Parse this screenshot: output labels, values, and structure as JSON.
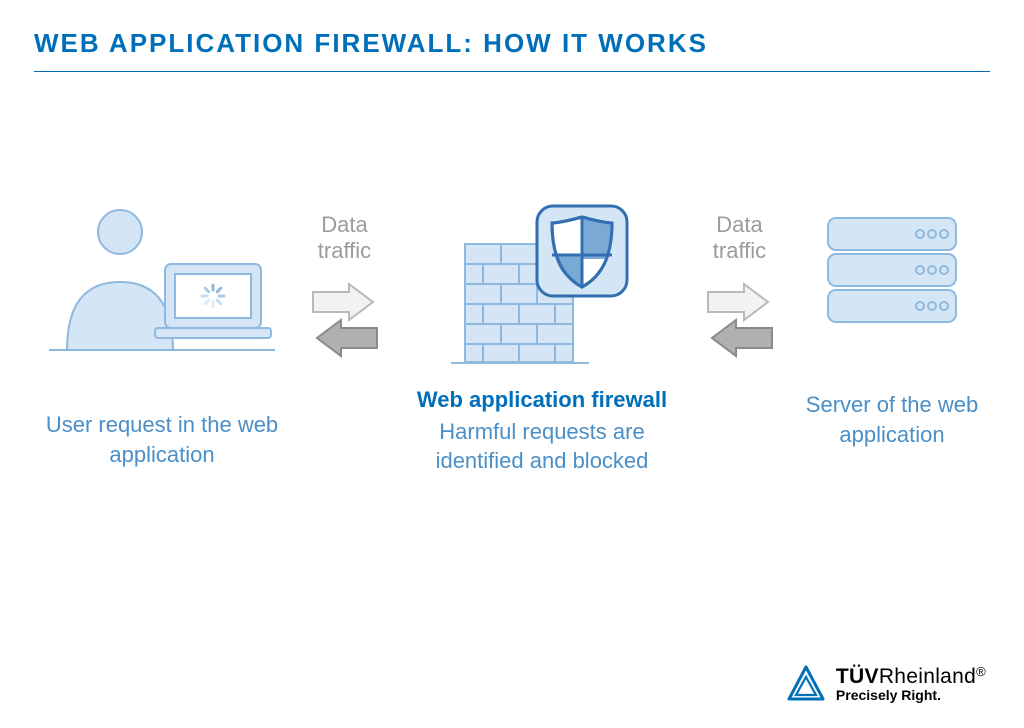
{
  "title": "WEB APPLICATION FIREWALL: HOW IT WORKS",
  "arrow_label_left": "Data traffic",
  "arrow_label_right": "Data traffic",
  "user_caption": "User request in the web application",
  "waf_title": "Web application firewall",
  "waf_sub": "Harmful requests are identified and blocked",
  "server_caption": "Server of the web application",
  "logo": {
    "brand_bold": "TÜV",
    "brand_light": "Rheinland",
    "reg": "®",
    "tagline": "Precisely Right."
  },
  "colors": {
    "primary": "#006fb9",
    "light_fill": "#d4e6f6",
    "light_stroke": "#8fb9df",
    "gray": "#9b9b9b",
    "dark_gray": "#6e6e6e"
  }
}
